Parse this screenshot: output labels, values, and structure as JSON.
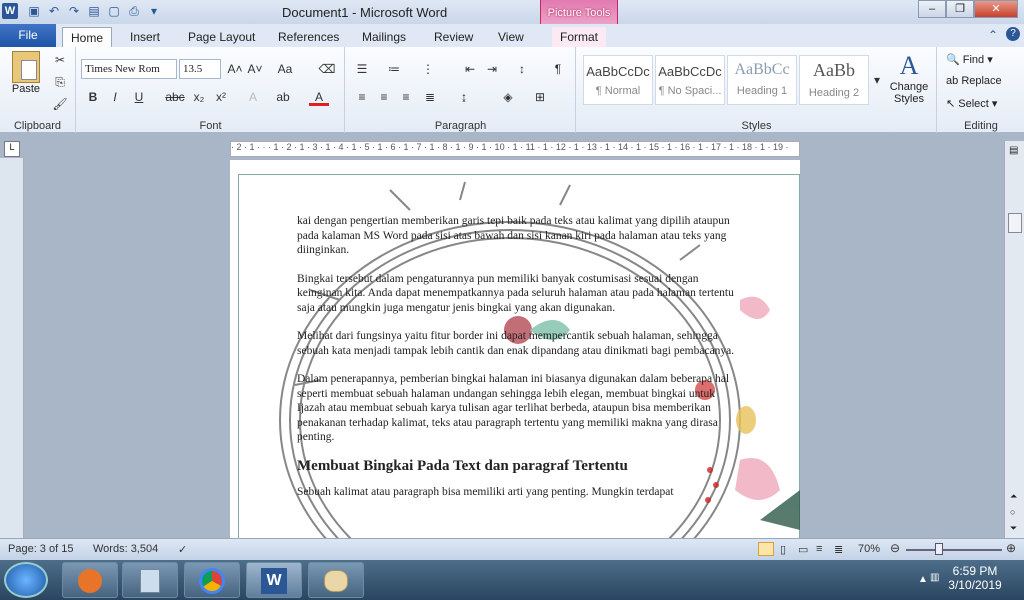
{
  "app": {
    "window_title": "Document1 - Microsoft Word",
    "contextual_tab_group": "Picture Tools",
    "qat_icons": [
      "word-icon",
      "save-icon",
      "undo-icon",
      "redo-icon",
      "open-icon",
      "new-icon",
      "print-preview-icon",
      "qat-menu-icon"
    ]
  },
  "tabs": [
    "File",
    "Home",
    "Insert",
    "Page Layout",
    "References",
    "Mailings",
    "Review",
    "View",
    "Format"
  ],
  "active_tab": "Home",
  "ribbon": {
    "clipboard": {
      "label": "Clipboard",
      "paste": "Paste"
    },
    "font": {
      "label": "Font",
      "name": "Times New Rom",
      "size": "13.5"
    },
    "paragraph": {
      "label": "Paragraph"
    },
    "styles": {
      "label": "Styles",
      "items": [
        {
          "preview": "AaBbCcDc",
          "name": "¶ Normal"
        },
        {
          "preview": "AaBbCcDc",
          "name": "¶ No Spaci..."
        },
        {
          "preview": "AaBbCc",
          "name": "Heading 1"
        },
        {
          "preview": "AaBb",
          "name": "Heading 2"
        }
      ],
      "change_styles": "Change Styles"
    },
    "editing": {
      "label": "Editing",
      "find": "Find",
      "replace": "Replace",
      "select": "Select"
    }
  },
  "document": {
    "paragraphs": [
      "kai dengan pengertian memberikan garis tepi baik pada teks atau kalimat yang dipilih ataupun pada kalaman MS Word pada sisi atas bawah dan sisi kanan kiri pada halaman atau teks yang diinginkan.",
      "Bingkai tersebut dalam pengaturannya pun memiliki banyak costumisasi sesuai dengan keinginan kita. Anda dapat menempatkannya pada seluruh halaman atau pada halaman tertentu saja atau mungkin juga mengatur jenis bingkai yang akan digunakan.",
      "Melihat dari fungsinya yaitu fitur border ini dapat mempercantik sebuah halaman, sehingga sebuah kata menjadi tampak lebih cantik dan enak dipandang atau dinikmati bagi pembacanya.",
      "Dalam penerapannya, pemberian bingkai halaman ini biasanya digunakan dalam beberapa hal seperti membuat sebuah halaman undangan sehingga lebih elegan, membuat bingkai untuk Ijazah atau membuat sebuah karya tulisan agar terlihat berbeda, ataupun bisa memberikan penakanan terhadap kalimat, teks atau paragraph tertentu yang memiliki makna yang dirasa penting."
    ],
    "heading": "Membuat Bingkai Pada Text dan paragraf Tertentu",
    "last_paragraph": "Sebuah kalimat atau paragraph bisa memiliki arti yang penting. Mungkin terdapat"
  },
  "status": {
    "page": "Page: 3 of 15",
    "words": "Words: 3,504",
    "zoom": "70%"
  },
  "taskbar": {
    "time": "6:59 PM",
    "date": "3/10/2019",
    "apps": [
      "start-orb-icon",
      "mozilla-icon",
      "notepad-icon",
      "chrome-icon",
      "word-icon",
      "paint-icon"
    ]
  },
  "colors": {
    "accent": "#2b5797",
    "picture_tools": "#e17ab0"
  }
}
